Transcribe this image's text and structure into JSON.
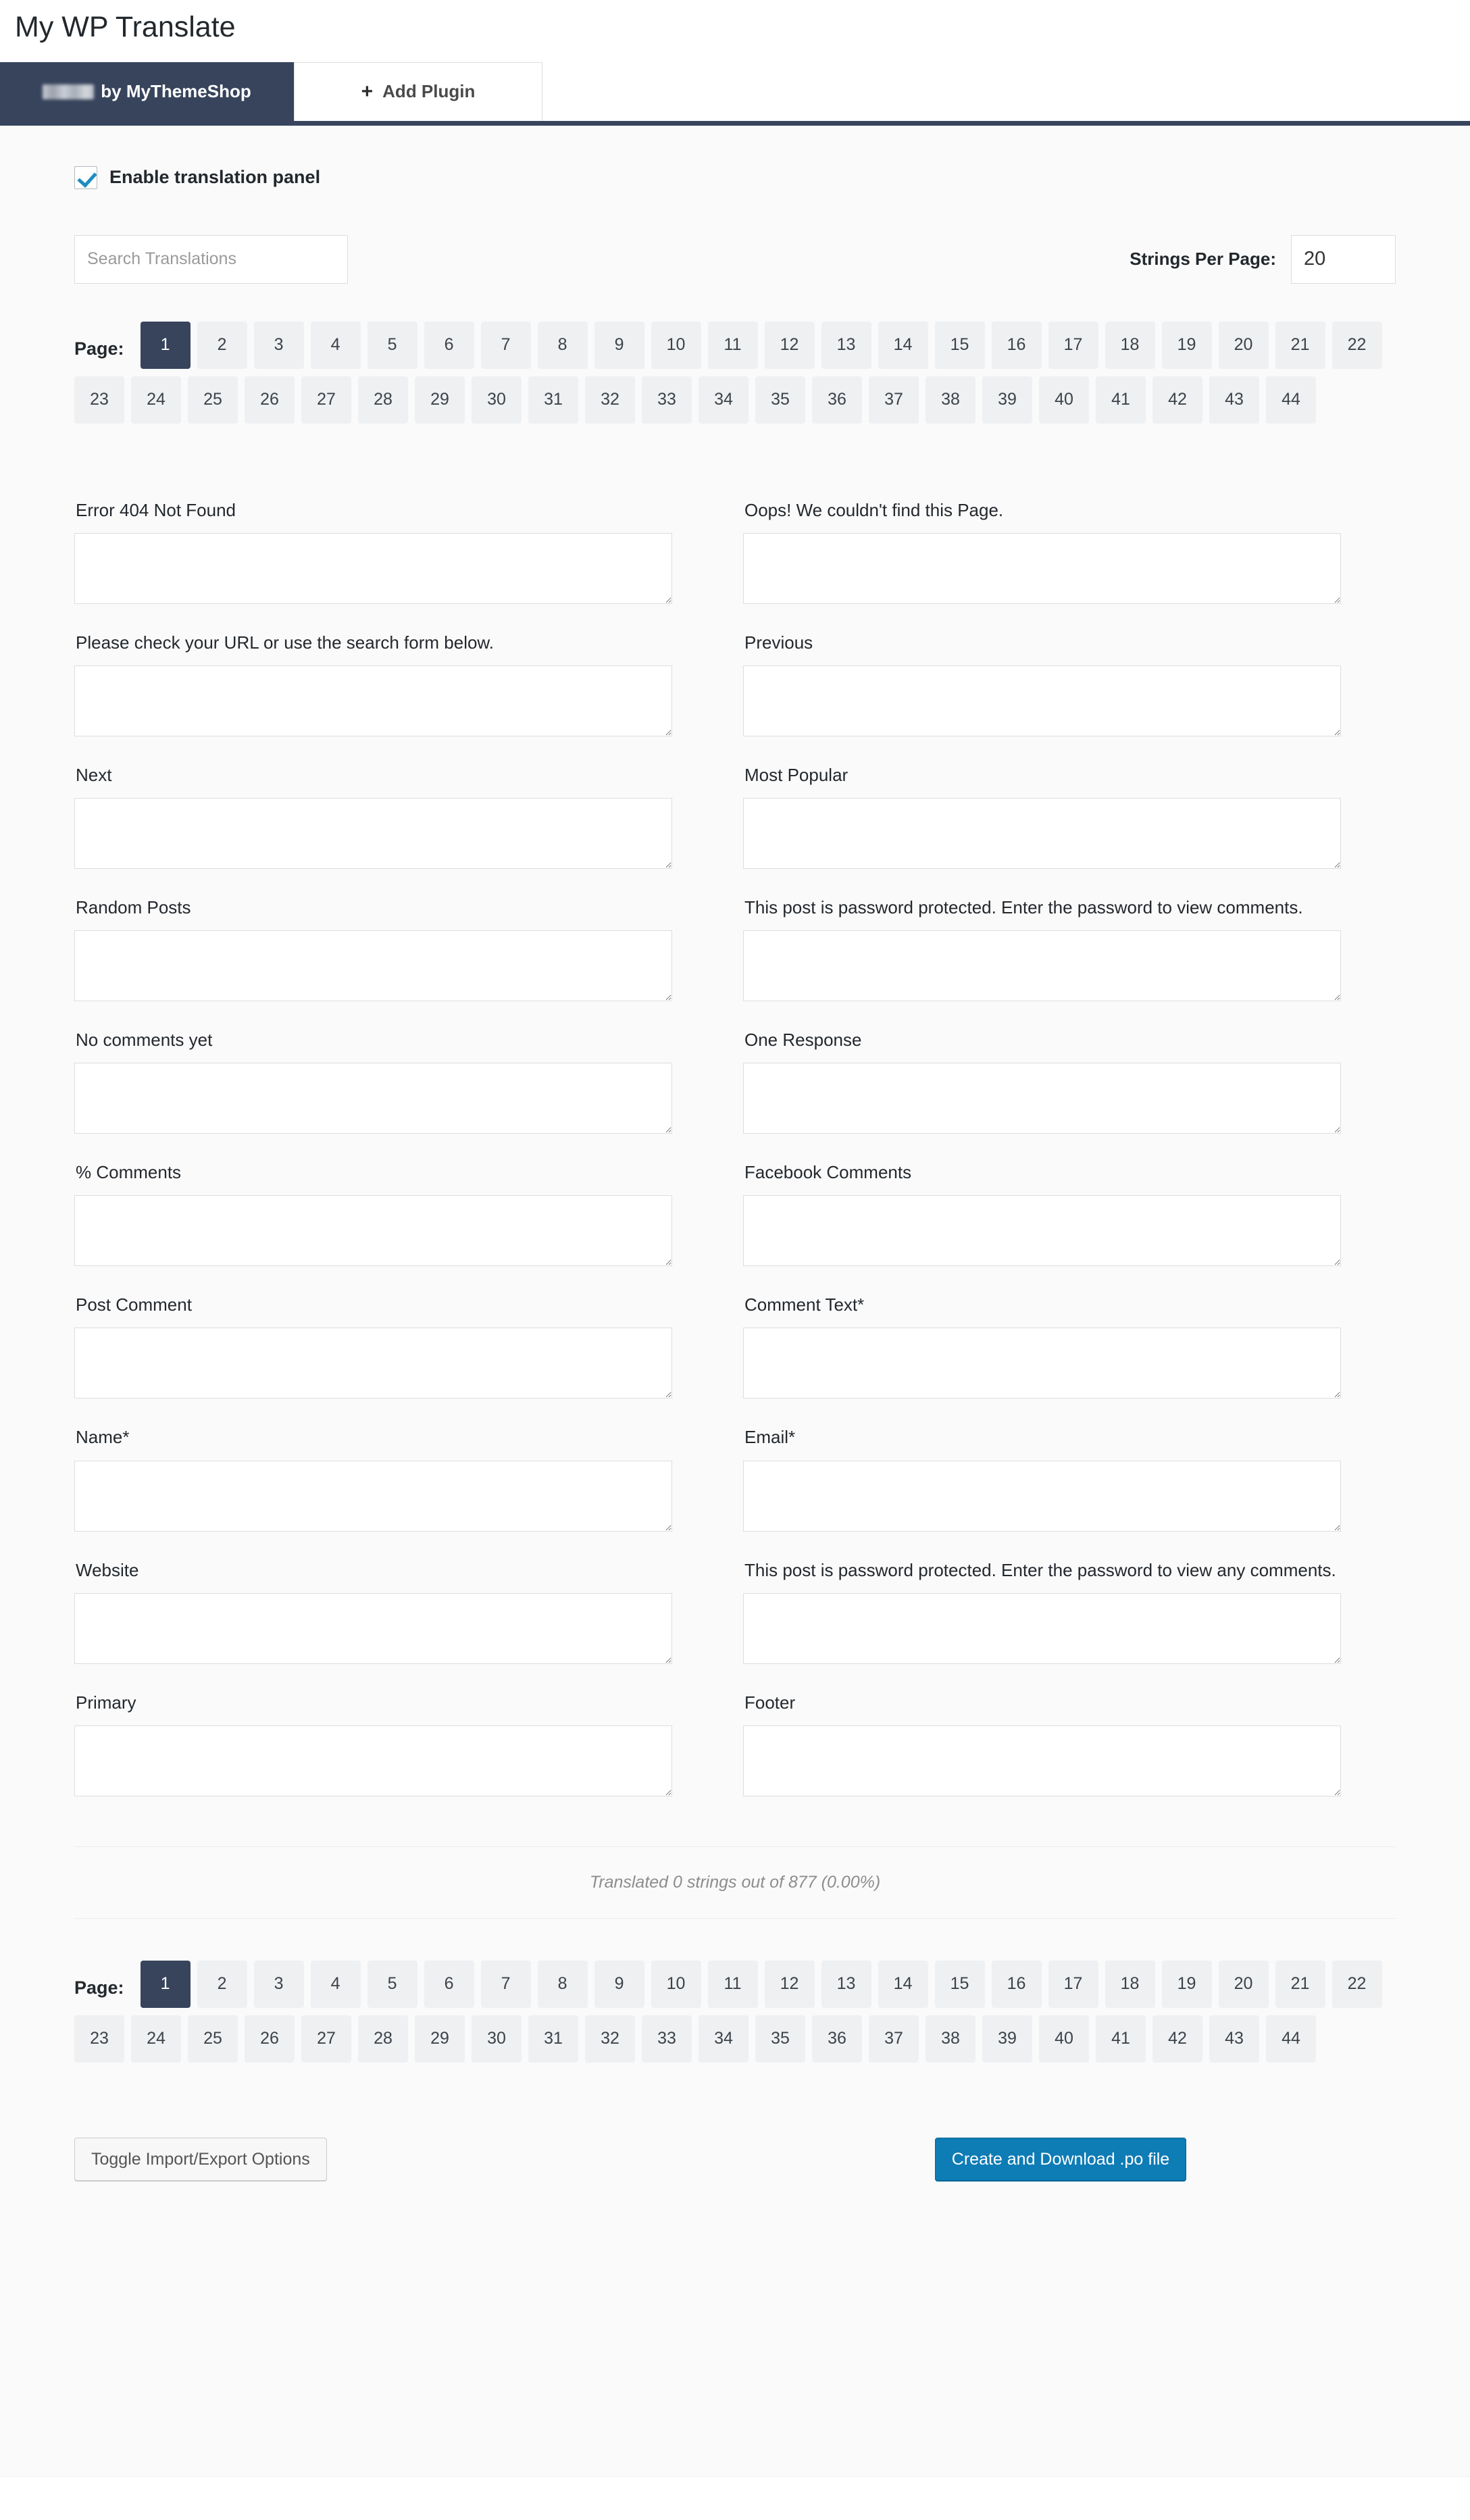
{
  "page": {
    "title": "My WP Translate"
  },
  "tabs": [
    {
      "label": "by MyThemeShop",
      "has_blurred_logo": true,
      "active": true
    },
    {
      "label": "Add Plugin",
      "icon": "plus-icon",
      "active": false
    }
  ],
  "settings": {
    "enable_panel_label": "Enable translation panel",
    "enable_panel_checked": true
  },
  "search": {
    "placeholder": "Search Translations",
    "value": ""
  },
  "strings_per_page": {
    "label": "Strings Per Page:",
    "value": "20"
  },
  "pagination": {
    "label": "Page:",
    "active": "1",
    "pages": [
      "1",
      "2",
      "3",
      "4",
      "5",
      "6",
      "7",
      "8",
      "9",
      "10",
      "11",
      "12",
      "13",
      "14",
      "15",
      "16",
      "17",
      "18",
      "19",
      "20",
      "21",
      "22",
      "23",
      "24",
      "25",
      "26",
      "27",
      "28",
      "29",
      "30",
      "31",
      "32",
      "33",
      "34",
      "35",
      "36",
      "37",
      "38",
      "39",
      "40",
      "41",
      "42",
      "43",
      "44"
    ]
  },
  "translations": [
    {
      "label": "Error 404 Not Found",
      "value": ""
    },
    {
      "label": "Oops! We couldn't find this Page.",
      "value": ""
    },
    {
      "label": "Please check your URL or use the search form below.",
      "value": ""
    },
    {
      "label": "Previous",
      "value": ""
    },
    {
      "label": "Next",
      "value": ""
    },
    {
      "label": "Most Popular",
      "value": ""
    },
    {
      "label": "Random Posts",
      "value": ""
    },
    {
      "label": "This post is password protected. Enter the password to view comments.",
      "value": ""
    },
    {
      "label": "No comments yet",
      "value": ""
    },
    {
      "label": "One Response",
      "value": ""
    },
    {
      "label": "% Comments",
      "value": ""
    },
    {
      "label": "Facebook Comments",
      "value": ""
    },
    {
      "label": "Post Comment",
      "value": ""
    },
    {
      "label": "Comment Text*",
      "value": ""
    },
    {
      "label": "Name*",
      "value": ""
    },
    {
      "label": "Email*",
      "value": ""
    },
    {
      "label": "Website",
      "value": ""
    },
    {
      "label": "This post is password protected. Enter the password to view any comments.",
      "value": ""
    },
    {
      "label": "Primary",
      "value": ""
    },
    {
      "label": "Footer",
      "value": ""
    }
  ],
  "status": {
    "text": "Translated 0 strings out of 877 (0.00%)"
  },
  "footer": {
    "toggle_label": "Toggle Import/Export Options",
    "download_label": "Create and Download .po file"
  },
  "colors": {
    "tab_active_bg": "#37445c",
    "primary_button_bg": "#0e7cb5",
    "checkbox_check": "#1e8cbe",
    "panel_bg": "#fafafa",
    "pager_bg": "#eef0f2"
  }
}
